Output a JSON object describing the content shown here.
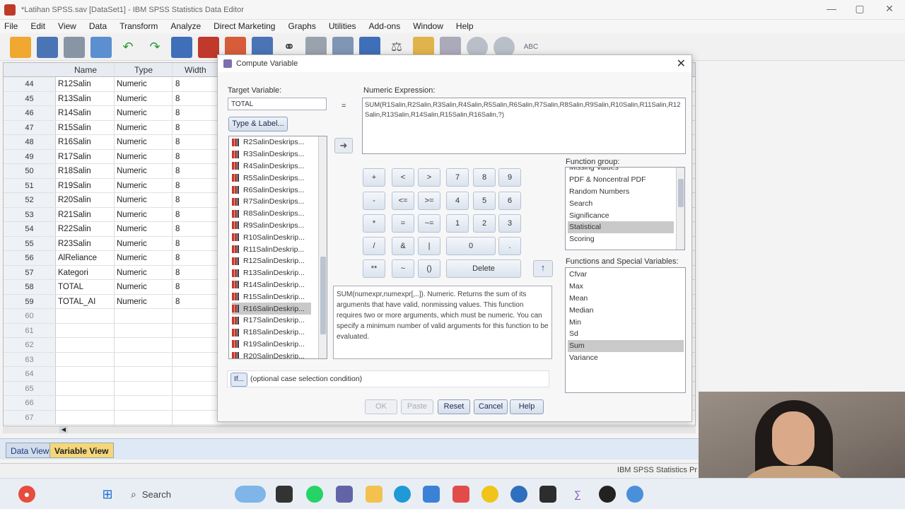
{
  "window": {
    "title": "*Latihan SPSS.sav [DataSet1] - IBM SPSS Statistics Data Editor",
    "controls": [
      "—",
      "▢",
      "✕"
    ]
  },
  "menu": [
    "File",
    "Edit",
    "View",
    "Data",
    "Transform",
    "Analyze",
    "Direct Marketing",
    "Graphs",
    "Utilities",
    "Add-ons",
    "Window",
    "Help"
  ],
  "toolbar_icons": [
    "open-icon",
    "save-icon",
    "print-icon",
    "dialog-recall-icon",
    "undo-icon",
    "redo-icon",
    "goto-case-icon",
    "goto-variable-icon",
    "variables-icon",
    "insert-case-icon",
    "insert-variable-icon",
    "binoculars-icon",
    "split-file-icon",
    "weight-cases-icon",
    "select-cases-icon",
    "value-labels-icon",
    "use-sets-icon",
    "show-all-icon",
    "spell-check-icon"
  ],
  "grid": {
    "headers": {
      "name": "Name",
      "type": "Type",
      "width": "Width"
    },
    "rows": [
      {
        "n": "44",
        "name": "R12Salin",
        "type": "Numeric",
        "width": "8"
      },
      {
        "n": "45",
        "name": "R13Salin",
        "type": "Numeric",
        "width": "8"
      },
      {
        "n": "46",
        "name": "R14Salin",
        "type": "Numeric",
        "width": "8"
      },
      {
        "n": "47",
        "name": "R15Salin",
        "type": "Numeric",
        "width": "8"
      },
      {
        "n": "48",
        "name": "R16Salin",
        "type": "Numeric",
        "width": "8"
      },
      {
        "n": "49",
        "name": "R17Salin",
        "type": "Numeric",
        "width": "8"
      },
      {
        "n": "50",
        "name": "R18Salin",
        "type": "Numeric",
        "width": "8"
      },
      {
        "n": "51",
        "name": "R19Salin",
        "type": "Numeric",
        "width": "8"
      },
      {
        "n": "52",
        "name": "R20Salin",
        "type": "Numeric",
        "width": "8"
      },
      {
        "n": "53",
        "name": "R21Salin",
        "type": "Numeric",
        "width": "8"
      },
      {
        "n": "54",
        "name": "R22Salin",
        "type": "Numeric",
        "width": "8"
      },
      {
        "n": "55",
        "name": "R23Salin",
        "type": "Numeric",
        "width": "8"
      },
      {
        "n": "56",
        "name": "AlReliance",
        "type": "Numeric",
        "width": "8"
      },
      {
        "n": "57",
        "name": "Kategori",
        "type": "Numeric",
        "width": "8"
      },
      {
        "n": "58",
        "name": "TOTAL",
        "type": "Numeric",
        "width": "8"
      },
      {
        "n": "59",
        "name": "TOTAL_AI",
        "type": "Numeric",
        "width": "8"
      },
      {
        "n": "60",
        "name": "",
        "type": "",
        "width": ""
      },
      {
        "n": "61",
        "name": "",
        "type": "",
        "width": ""
      },
      {
        "n": "62",
        "name": "",
        "type": "",
        "width": ""
      },
      {
        "n": "63",
        "name": "",
        "type": "",
        "width": ""
      },
      {
        "n": "64",
        "name": "",
        "type": "",
        "width": ""
      },
      {
        "n": "65",
        "name": "",
        "type": "",
        "width": ""
      },
      {
        "n": "66",
        "name": "",
        "type": "",
        "width": ""
      },
      {
        "n": "67",
        "name": "",
        "type": "",
        "width": ""
      }
    ]
  },
  "tabs": {
    "data_view": "Data View",
    "variable_view": "Variable View"
  },
  "status": "IBM SPSS Statistics Pr",
  "dialog": {
    "title": "Compute Variable",
    "target_label": "Target Variable:",
    "target_value": "TOTAL",
    "equals": "=",
    "expr_label": "Numeric Expression:",
    "expr_value": "SUM(R1Salin,R2Salin,R3Salin,R4Salin,R5Salin,R6Salin,R7Salin,R8Salin,R9Salin,R10Salin,R11Salin,R12Salin,R13Salin,R14Salin,R15Salin,R16Salin,?)",
    "type_label_btn": "Type & Label...",
    "variables": [
      "R2SalinDeskrips...",
      "R3SalinDeskrips...",
      "R4SalinDeskrips...",
      "R5SalinDeskrips...",
      "R6SalinDeskrips...",
      "R7SalinDeskrips...",
      "R8SalinDeskrips...",
      "R9SalinDeskrips...",
      "R10SalinDeskrip...",
      "R11SalinDeskrip...",
      "R12SalinDeskrip...",
      "R13SalinDeskrip...",
      "R14SalinDeskrip...",
      "R15SalinDeskrip...",
      "R16SalinDeskrip...",
      "R17SalinDeskrip...",
      "R18SalinDeskrip...",
      "R19SalinDeskrip...",
      "R20SalinDeskrip..."
    ],
    "selected_variable": "R16SalinDeskrip...",
    "keypad": [
      "+",
      "<",
      ">",
      "7",
      "8",
      "9",
      "-",
      "<=",
      ">=",
      "4",
      "5",
      "6",
      "*",
      "=",
      "~=",
      "1",
      "2",
      "3",
      "/",
      "&",
      "|",
      "0",
      ".",
      "**",
      "~",
      "()",
      "Delete"
    ],
    "description": "SUM(numexpr,numexpr[,..]). Numeric. Returns the sum of its arguments that have valid, nonmissing values. This function requires two or more arguments, which must be numeric. You can specify a minimum number of valid arguments for this function to be evaluated.",
    "function_group_label": "Function group:",
    "function_groups": [
      "Missing Values",
      "PDF & Noncentral PDF",
      "Random Numbers",
      "Search",
      "Significance",
      "Statistical",
      "Scoring"
    ],
    "selected_group": "Statistical",
    "functions_label": "Functions and Special Variables:",
    "functions": [
      "Cfvar",
      "Max",
      "Mean",
      "Median",
      "Min",
      "Sd",
      "Sum",
      "Variance"
    ],
    "selected_function": "Sum",
    "if_button": "If...",
    "if_text": "(optional case selection condition)",
    "buttons": {
      "ok": "OK",
      "paste": "Paste",
      "reset": "Reset",
      "cancel": "Cancel",
      "help": "Help"
    }
  },
  "taskbar": {
    "search_placeholder": "Search",
    "icons": [
      "notification-icon",
      "start-icon",
      "search-icon",
      "game-icon",
      "file-explorer-icon",
      "whatsapp-icon",
      "teams-icon",
      "folder-icon",
      "edge-icon",
      "store-icon",
      "wps-icon",
      "chrome-icon",
      "app-icon",
      "spreadsheet-icon",
      "mathtype-icon",
      "obs-icon",
      "spss-icon"
    ]
  }
}
